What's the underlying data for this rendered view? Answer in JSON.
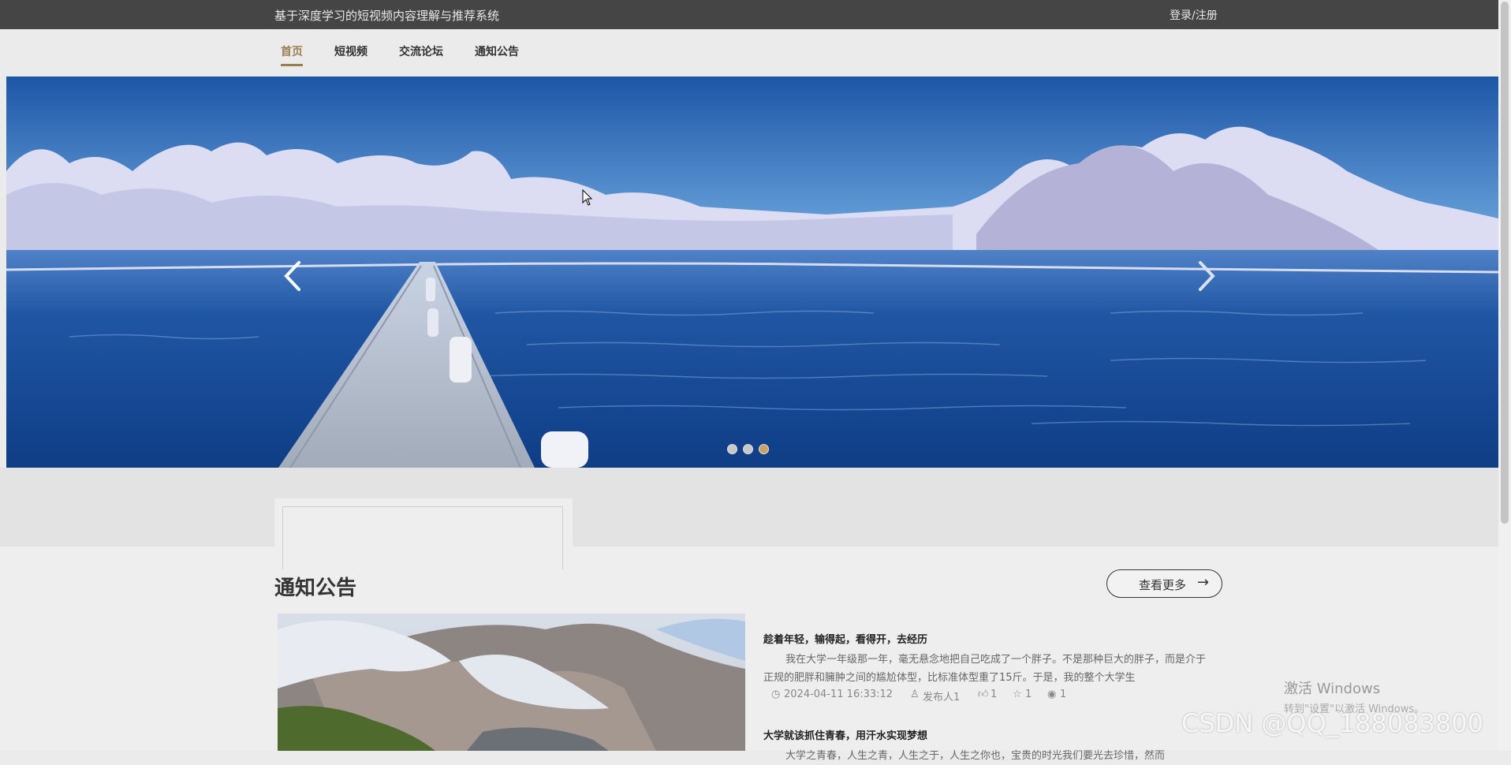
{
  "header": {
    "site_title": "基于深度学习的短视频内容理解与推荐系统",
    "login_label": "登录/注册"
  },
  "nav": {
    "items": [
      {
        "label": "首页",
        "active": true
      },
      {
        "label": "短视频",
        "active": false
      },
      {
        "label": "交流论坛",
        "active": false
      },
      {
        "label": "通知公告",
        "active": false
      }
    ]
  },
  "carousel": {
    "slide_count": 3,
    "active_slide": 3,
    "prev_icon": "chevron-left-icon",
    "next_icon": "chevron-right-icon"
  },
  "notices_section": {
    "title": "通知公告",
    "more_label": "查看更多",
    "more_icon": "→",
    "items": [
      {
        "title": "趁着年轻，输得起，看得开，去经历",
        "excerpt": "我在大学一年级那一年，毫无悬念地把自己吃成了一个胖子。不是那种巨大的胖子，而是介于正规的肥胖和臃肿之间的尴尬体型，比标准体型重了15斤。于是，我的整个大学生",
        "date": "2024-04-11 16:33:12",
        "author": "发布人1",
        "likes": "1",
        "favorites": "1",
        "views": "1"
      },
      {
        "title": "大学就该抓住青春，用汗水实现梦想",
        "excerpt": "大学之青春，人生之青，人生之于，人生之你也，宝贵的时光我们要光去珍惜，然而"
      }
    ]
  },
  "overlays": {
    "windows_activation_title": "激活 Windows",
    "windows_activation_sub": "转到\"设置\"以激活 Windows。",
    "csdn_watermark": "CSDN @QQ_188083800"
  },
  "colors": {
    "top_bar": "#454545",
    "accent": "#9a7f52",
    "active_dot": "#c7a466"
  }
}
